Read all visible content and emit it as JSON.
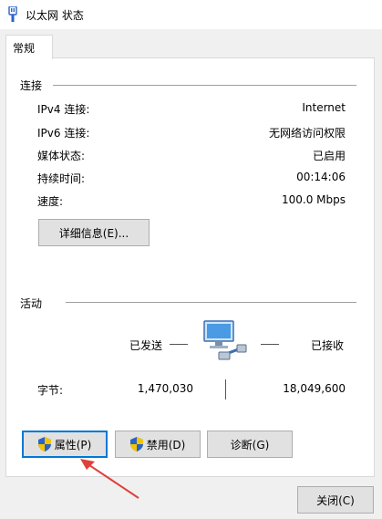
{
  "window": {
    "title": "以太网 状态"
  },
  "tabs": [
    {
      "label": "常规"
    }
  ],
  "connection": {
    "header": "连接",
    "rows": [
      {
        "label": "IPv4 连接:",
        "value": "Internet"
      },
      {
        "label": "IPv6 连接:",
        "value": "无网络访问权限"
      },
      {
        "label": "媒体状态:",
        "value": "已启用"
      },
      {
        "label": "持续时间:",
        "value": "00:14:06"
      },
      {
        "label": "速度:",
        "value": "100.0 Mbps"
      }
    ],
    "details_button": "详细信息(E)..."
  },
  "activity": {
    "header": "活动",
    "sent_label": "已发送",
    "received_label": "已接收",
    "bytes_label": "字节:",
    "bytes_sent": "1,470,030",
    "bytes_received": "18,049,600"
  },
  "buttons": {
    "properties": "属性(P)",
    "disable": "禁用(D)",
    "diagnose": "诊断(G)",
    "close": "关闭(C)"
  },
  "colors": {
    "accent": "#0078d7",
    "annotation_arrow": "#e0403a",
    "shield_blue": "#2a64c8",
    "shield_yellow": "#f5c400"
  },
  "icons": {
    "title": "network-adapter-icon",
    "activity": "network-computer-icon",
    "button": "uac-shield-icon"
  }
}
